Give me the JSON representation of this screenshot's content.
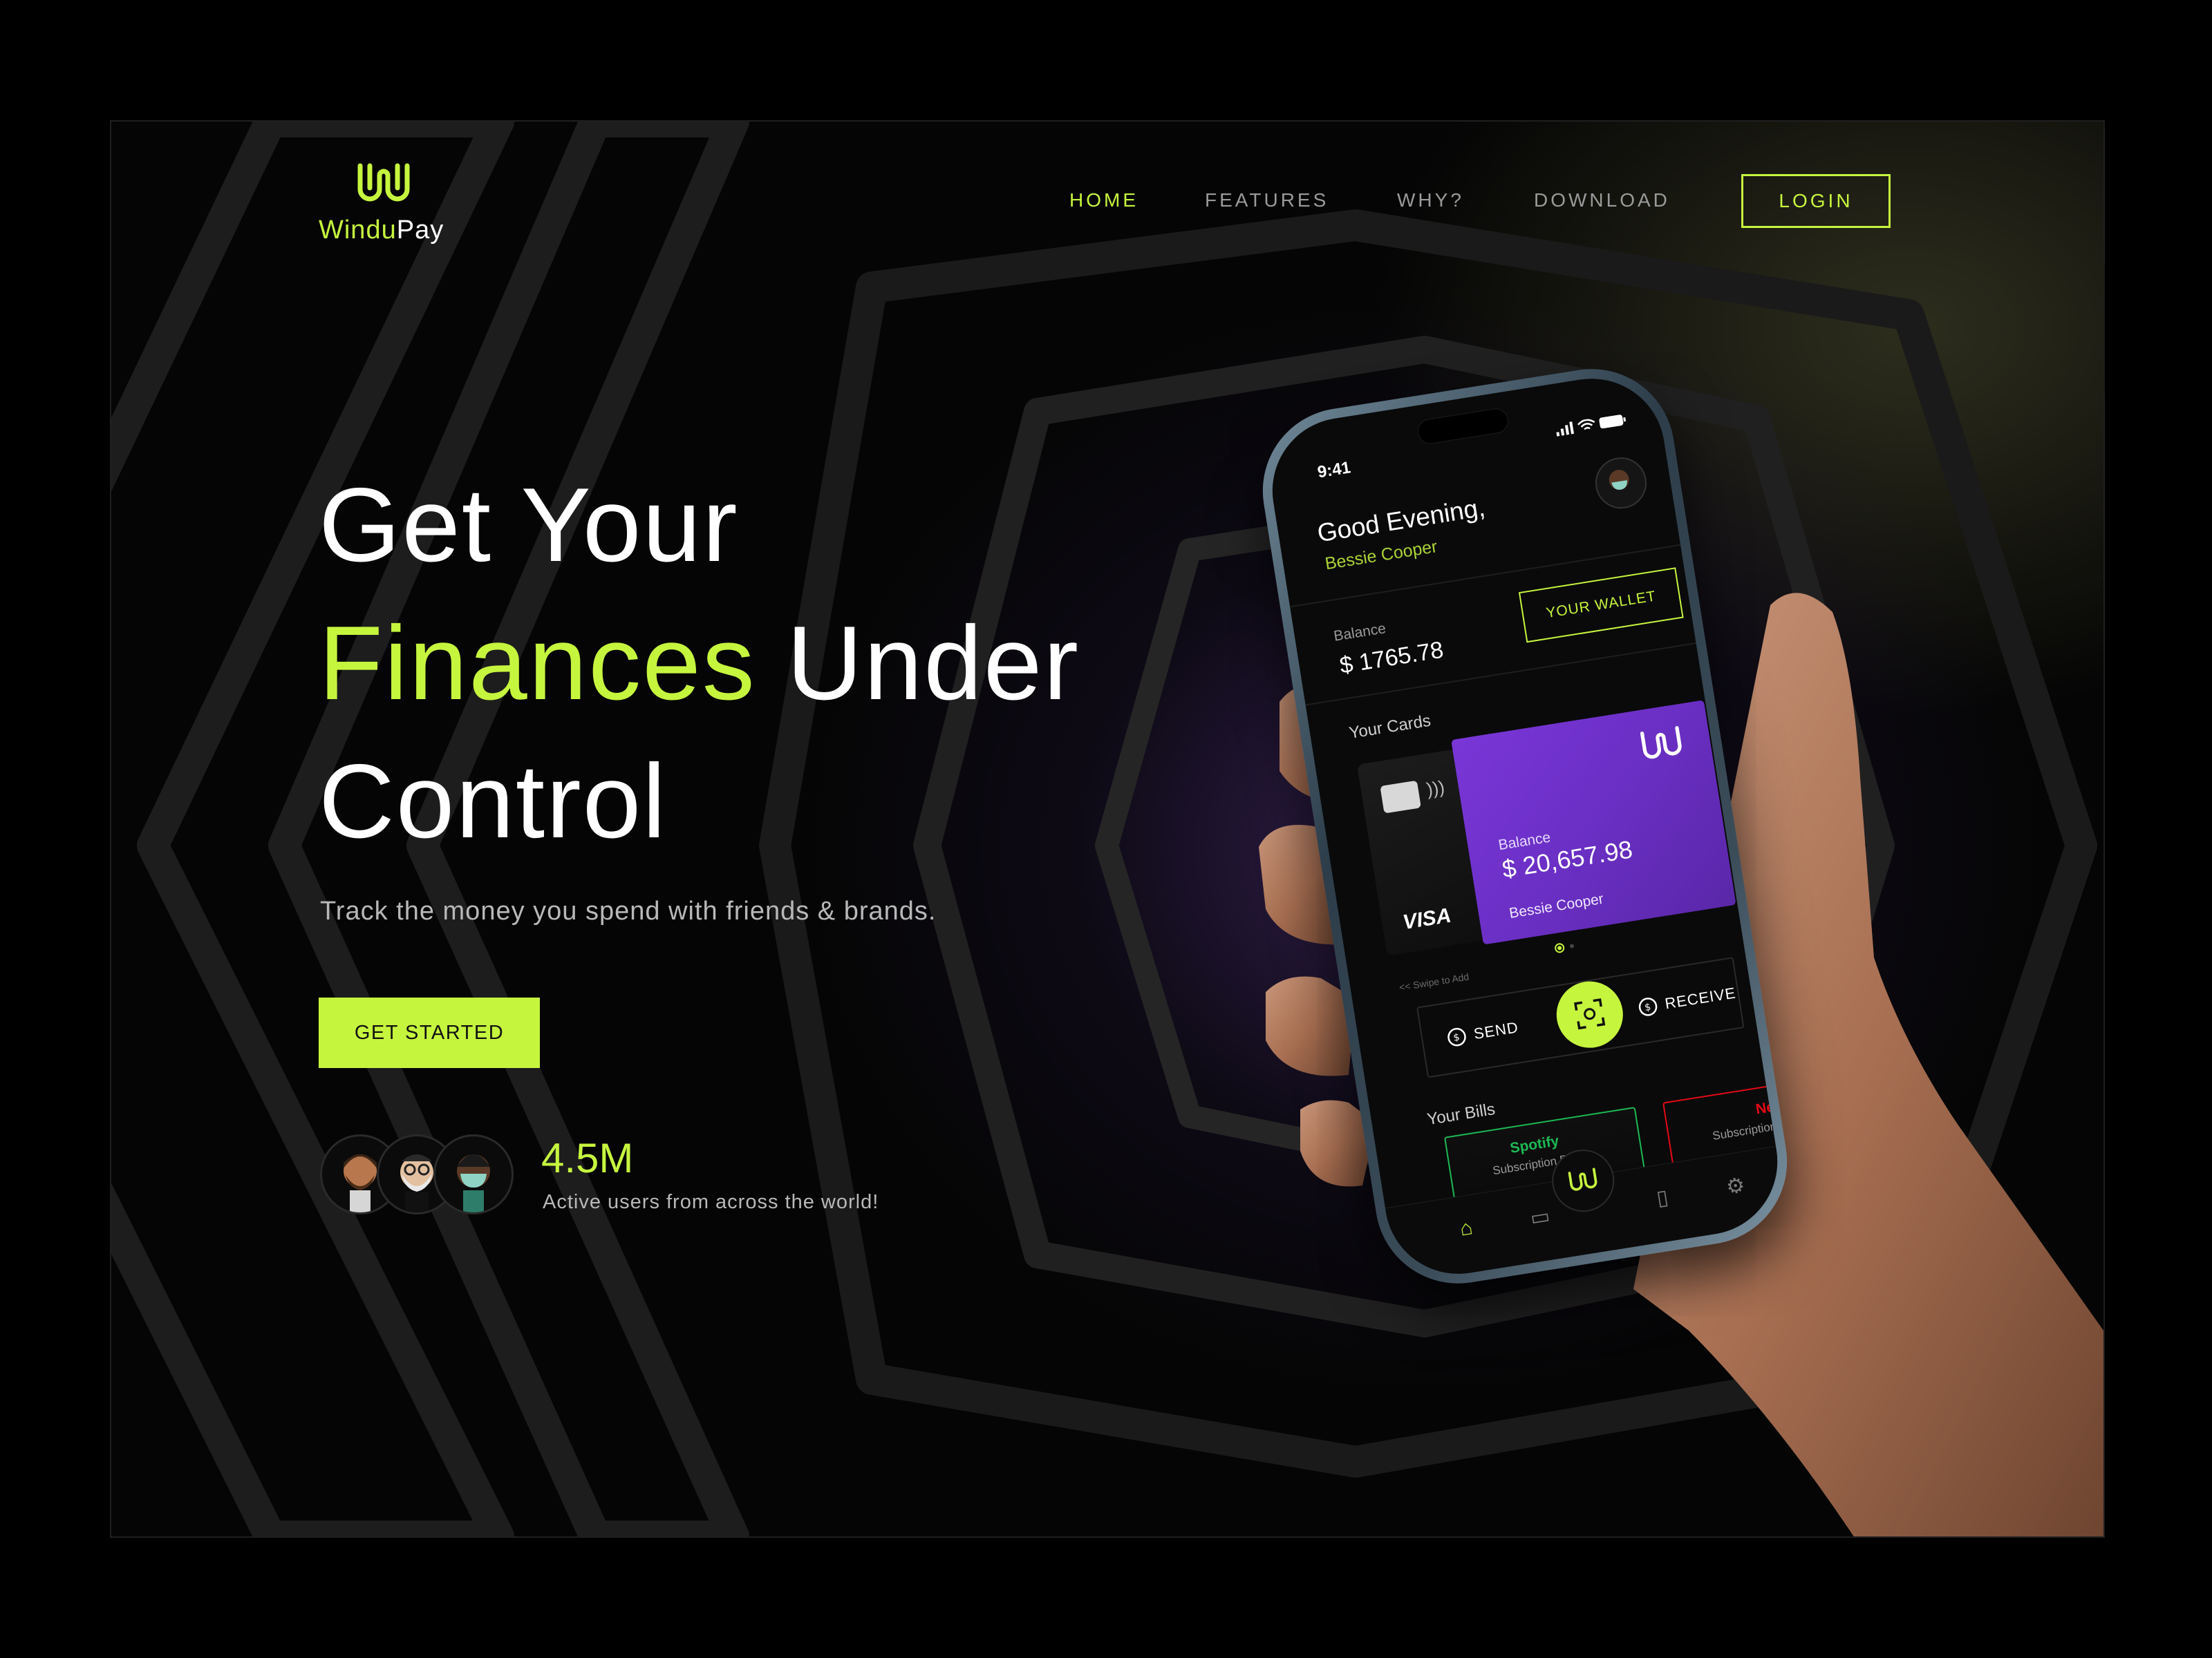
{
  "header": {
    "logo": {
      "part1": "Windu",
      "part2": "Pay"
    },
    "nav": [
      {
        "label": "HOME",
        "active": true
      },
      {
        "label": "FEATURES",
        "active": false
      },
      {
        "label": "WHY?",
        "active": false
      },
      {
        "label": "DOWNLOAD",
        "active": false
      }
    ],
    "login_label": "LOGIN"
  },
  "hero": {
    "line1": "Get Your",
    "line2_accent": "Finances",
    "line2_rest": "Under",
    "line3": "Control",
    "subtitle": "Track the money you spend with friends & brands.",
    "cta_label": "GET STARTED",
    "users_count": "4.5M",
    "users_label": "Active users from across the world!"
  },
  "phone": {
    "status_time": "9:41",
    "greeting": "Good Evening,",
    "user_name": "Bessie Cooper",
    "balance_label": "Balance",
    "balance_value": "$ 1765.78",
    "wallet_button": "YOUR WALLET",
    "cards_title": "Your Cards",
    "card_brand": "VISA",
    "card_balance_label": "Balance",
    "card_balance_value": "$ 20,657.98",
    "card_holder": "Bessie Cooper",
    "swipe_hint": "<< Swipe to Add",
    "send_label": "SEND",
    "receive_label": "RECEIVE",
    "bills_title": "Your Bills",
    "bills": [
      {
        "name": "Spotify",
        "plan": "Subscription Plan",
        "color": "#1db954"
      },
      {
        "name": "Netflix",
        "plan": "Subscription Pl",
        "color": "#e50914"
      }
    ]
  },
  "colors": {
    "accent": "#c6f53e",
    "card_purple": "#6a2fc4",
    "background": "#050505"
  },
  "icons": [
    "logo-icon",
    "avatar-man-beard",
    "avatar-man-glasses",
    "avatar-man-mask",
    "signal-icon",
    "wifi-icon",
    "battery-icon",
    "chip-icon",
    "nfc-icon",
    "send-icon",
    "scan-icon",
    "receive-icon",
    "home-icon",
    "wallet-icon",
    "cards-icon",
    "settings-icon"
  ]
}
